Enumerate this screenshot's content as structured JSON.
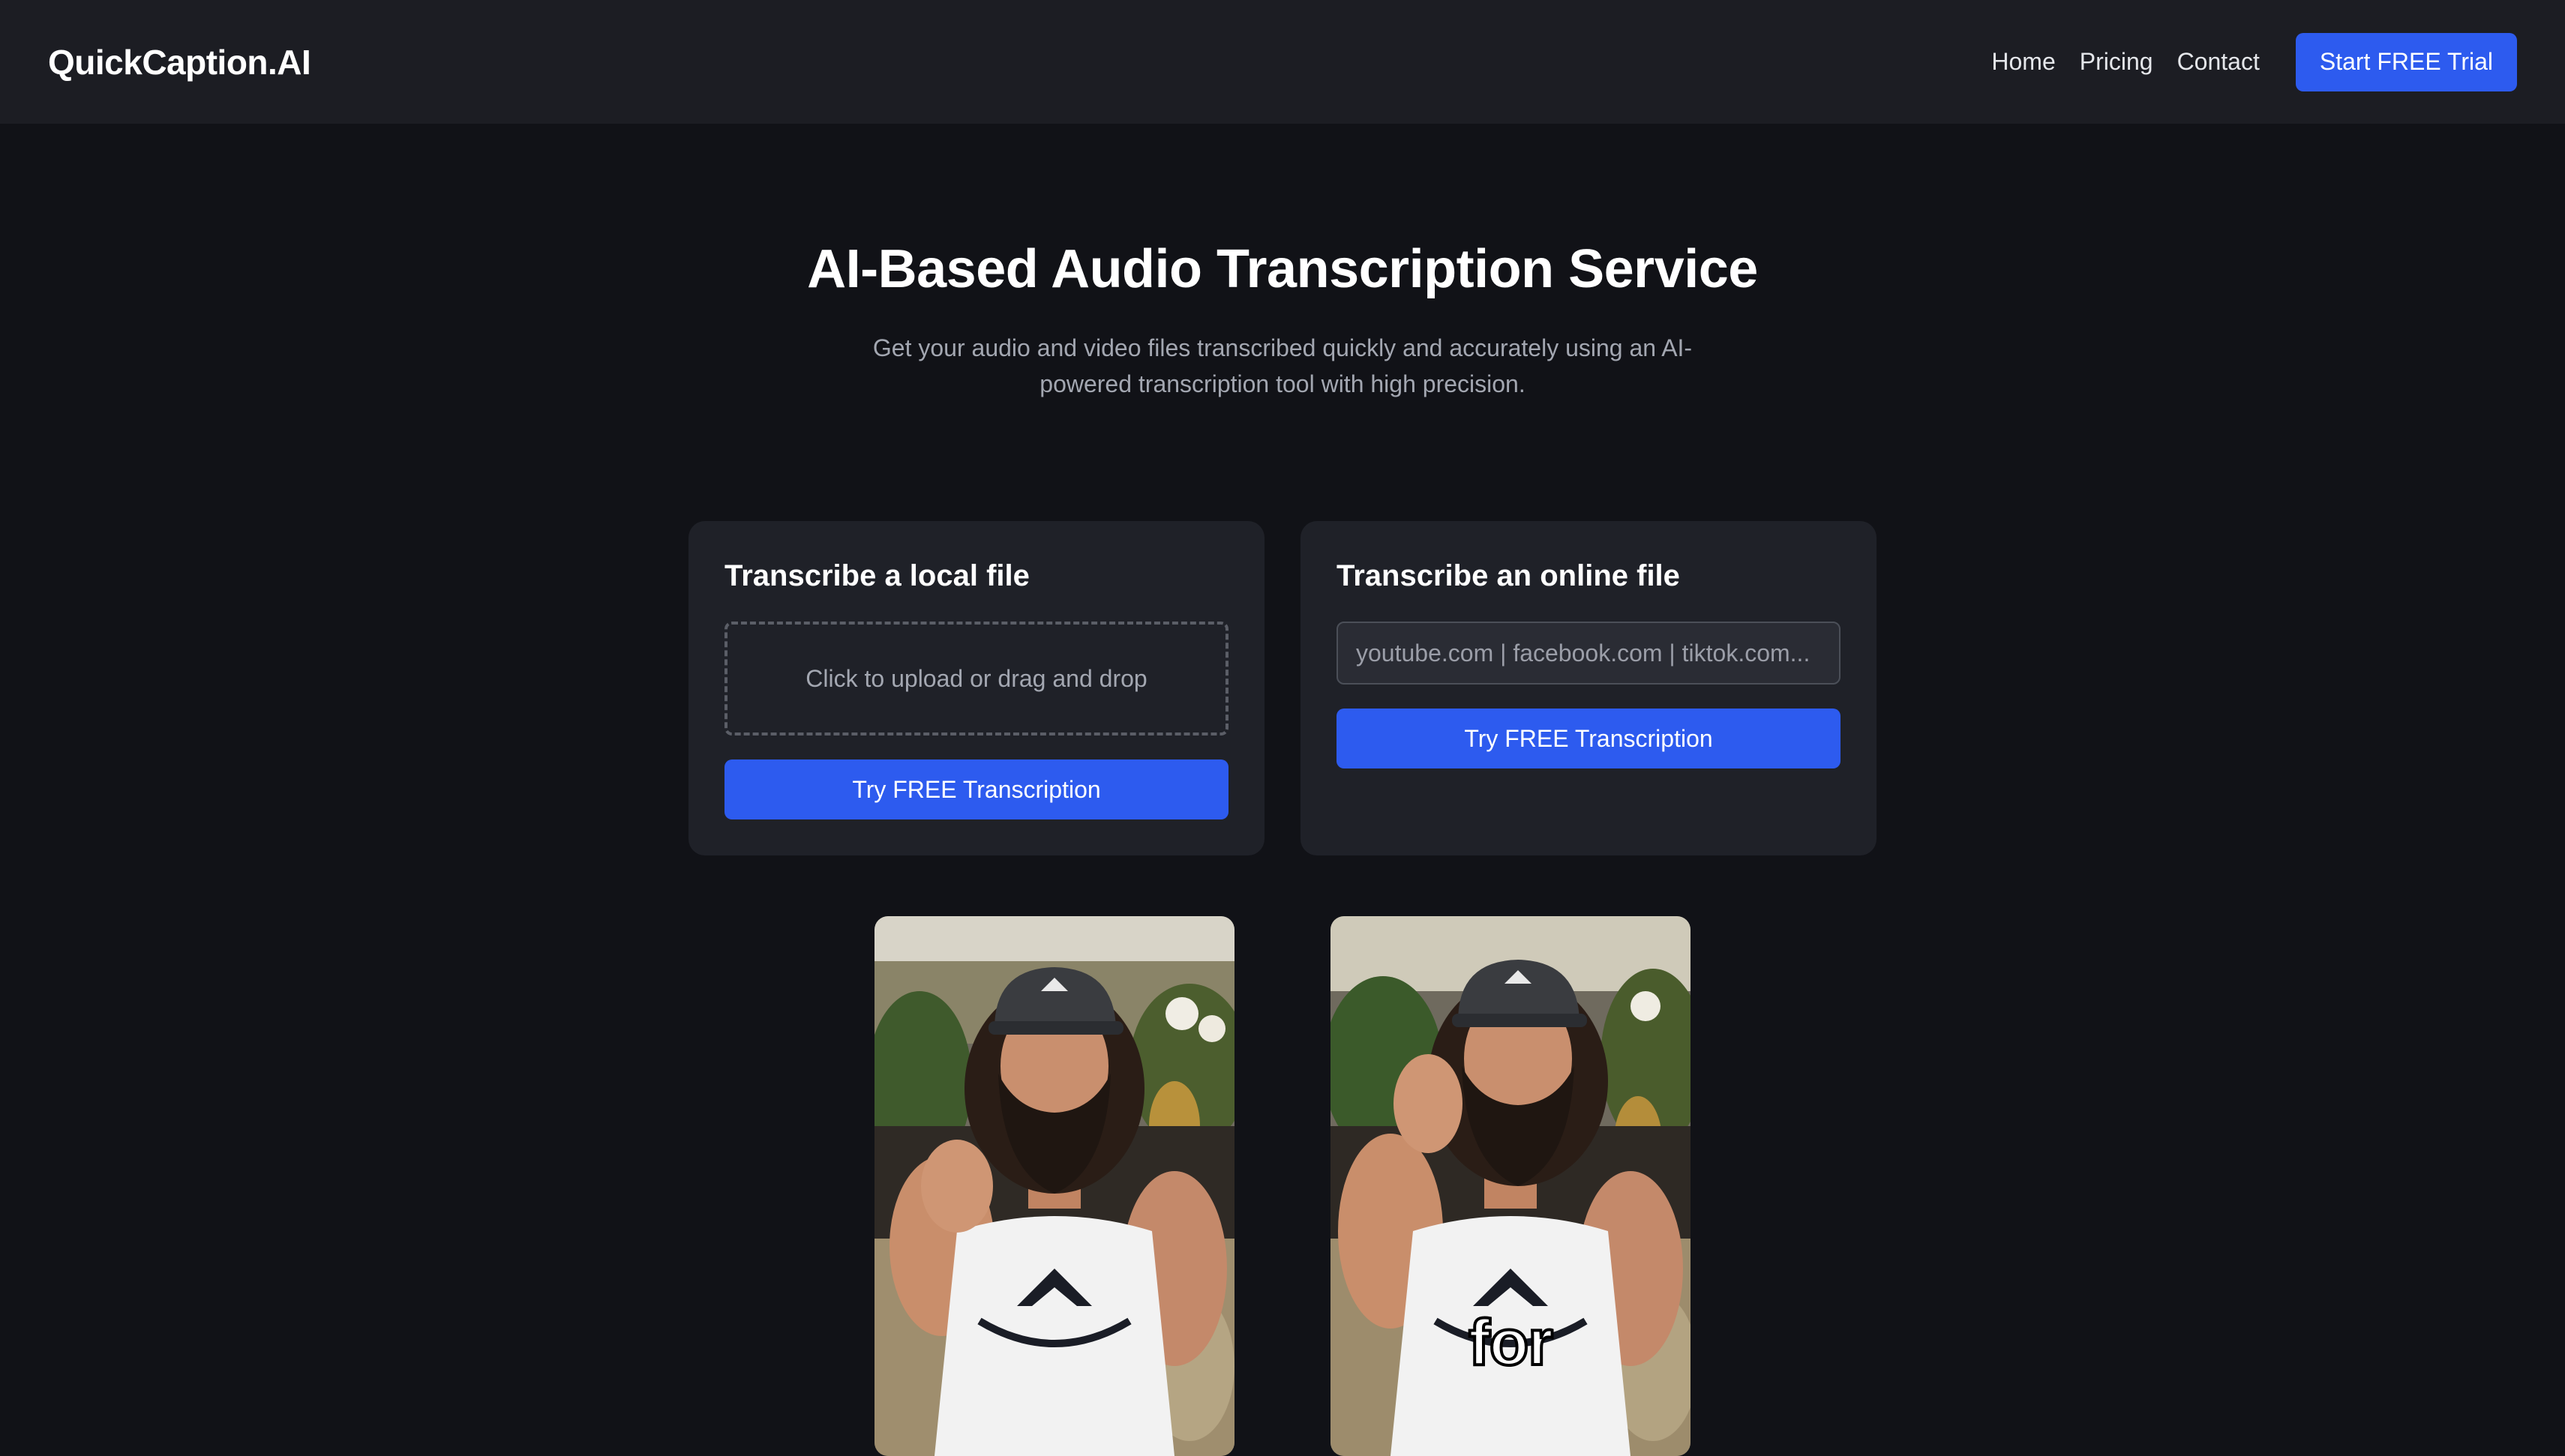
{
  "header": {
    "logo": "QuickCaption.AI",
    "nav": [
      "Home",
      "Pricing",
      "Contact"
    ],
    "cta_label": "Start FREE Trial"
  },
  "hero": {
    "title": "AI-Based Audio Transcription Service",
    "subtitle": "Get your audio and video files transcribed quickly and accurately using an AI-powered transcription tool with high precision."
  },
  "local_card": {
    "title": "Transcribe a local file",
    "dropzone_text": "Click to upload or drag and drop",
    "button_label": "Try FREE Transcription"
  },
  "online_card": {
    "title": "Transcribe an online file",
    "input_placeholder": "youtube.com | facebook.com | tiktok.com...",
    "input_value": "",
    "button_label": "Try FREE Transcription"
  },
  "videos": {
    "left": {
      "caption": ""
    },
    "right": {
      "caption": "for"
    }
  },
  "colors": {
    "background": "#111217",
    "header": "#1c1d23",
    "card": "#1f2128",
    "accent": "#2d5bef",
    "muted_text": "#a3a7b1"
  },
  "icons": {
    "video_thumbnail": "person-video-thumbnail"
  }
}
